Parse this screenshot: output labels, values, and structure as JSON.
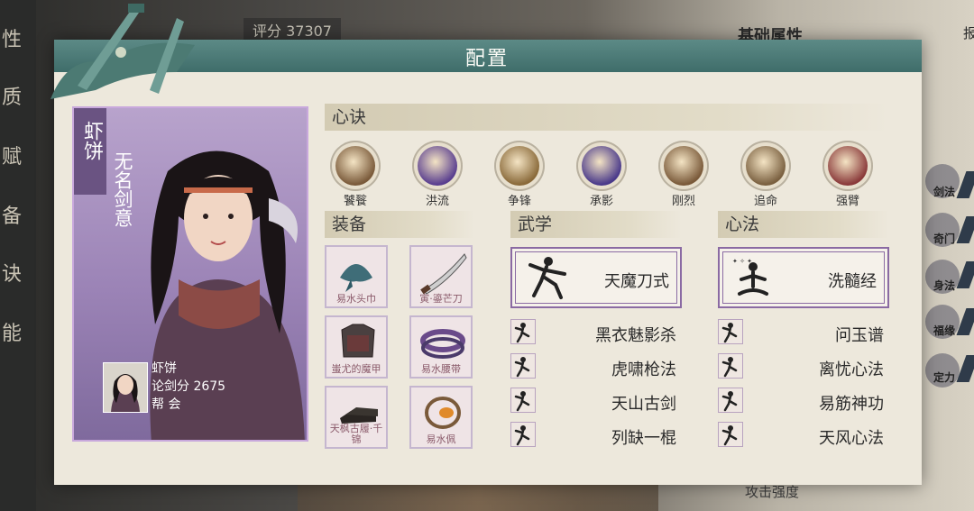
{
  "background": {
    "score_label": "评分 37307",
    "left_tabs": [
      "性",
      "质",
      "赋",
      "备",
      "诀",
      "能"
    ],
    "right_title": "基础属性",
    "right_tab": "报",
    "right_items": [
      "剑法",
      "奇门",
      "身法",
      "福缘",
      "定力"
    ],
    "bottom_text": "攻击强度"
  },
  "dialog": {
    "title": "配置"
  },
  "character": {
    "name": "虾饼",
    "title": "无名剑意",
    "player_name": "虾饼",
    "lunjian_score": "论剑分 2675",
    "guild": "帮  会"
  },
  "xinjue": {
    "header": "心诀",
    "items": [
      {
        "label": "饕餮",
        "color": "#7a5a3a"
      },
      {
        "label": "洪流",
        "color": "#5a3f8f"
      },
      {
        "label": "争锋",
        "color": "#8a6a3a"
      },
      {
        "label": "承影",
        "color": "#4a3a8a"
      },
      {
        "label": "刚烈",
        "color": "#7a5a3a"
      },
      {
        "label": "追命",
        "color": "#7a6040"
      },
      {
        "label": "强臂",
        "color": "#8a3a3a"
      }
    ]
  },
  "equipment": {
    "header": "装备",
    "items": [
      {
        "name": "易水头巾",
        "icon": "headscarf-icon"
      },
      {
        "name": "寅·鎏芒刀",
        "icon": "saber-icon"
      },
      {
        "name": "蚩尤的魔甲",
        "icon": "armor-icon"
      },
      {
        "name": "易水腰带",
        "icon": "belt-icon"
      },
      {
        "name": "天枫古履·千锦",
        "icon": "boots-icon"
      },
      {
        "name": "易水佩",
        "icon": "pendant-icon"
      }
    ]
  },
  "wuxue": {
    "header": "武学",
    "main": "天魔刀式",
    "skills": [
      "黑衣魅影杀",
      "虎啸枪法",
      "天山古剑",
      "列缺一棍"
    ]
  },
  "xinfa": {
    "header": "心法",
    "main": "洗髓经",
    "skills": [
      "问玉谱",
      "离忧心法",
      "易筋神功",
      "天风心法"
    ]
  }
}
